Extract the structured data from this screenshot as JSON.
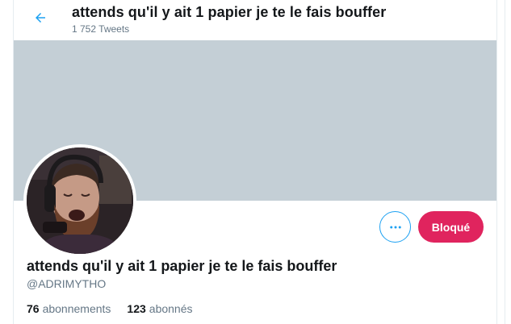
{
  "header": {
    "title": "attends qu'il y ait 1 papier je te le fais bouffer",
    "tweet_count": "1 752 Tweets",
    "back_icon": "arrow-left-icon"
  },
  "colors": {
    "accent": "#1da1f2",
    "blocked": "#e0245e",
    "banner": "#c4cfd6",
    "muted": "#657786"
  },
  "actions": {
    "more_icon": "more-dots-icon",
    "blocked_label": "Bloqué"
  },
  "profile": {
    "display_name": "attends qu'il y ait 1 papier je te le fais bouffer",
    "handle": "@ADRIMYTHO",
    "following_count": "76",
    "following_label": "abonnements",
    "followers_count": "123",
    "followers_label": "abonnés"
  }
}
